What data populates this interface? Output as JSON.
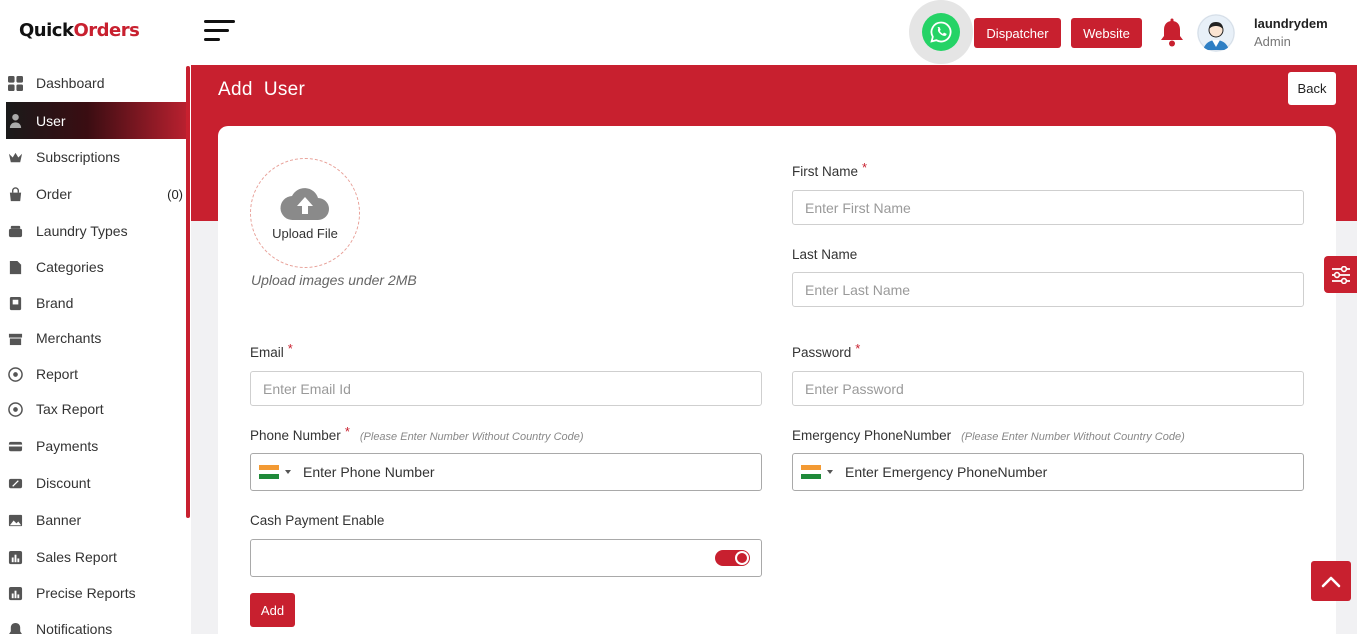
{
  "brand": {
    "logo_prefix": "Quick",
    "logo_mark": "O",
    "logo_suffix": "rders"
  },
  "sidebar": {
    "items": [
      {
        "label": "Dashboard",
        "icon": "dashboard-icon"
      },
      {
        "label": "User",
        "icon": "user-icon",
        "active": true
      },
      {
        "label": "Subscriptions",
        "icon": "crown-icon"
      },
      {
        "label": "Order",
        "icon": "bag-icon",
        "count": "(0)"
      },
      {
        "label": "Laundry Types",
        "icon": "laundry-icon"
      },
      {
        "label": "Categories",
        "icon": "categories-icon"
      },
      {
        "label": "Brand",
        "icon": "brand-icon"
      },
      {
        "label": "Merchants",
        "icon": "merchants-icon"
      },
      {
        "label": "Report",
        "icon": "report-icon"
      },
      {
        "label": "Tax Report",
        "icon": "tax-report-icon"
      },
      {
        "label": "Payments",
        "icon": "payments-icon"
      },
      {
        "label": "Discount",
        "icon": "discount-icon"
      },
      {
        "label": "Banner",
        "icon": "banner-icon"
      },
      {
        "label": "Sales Report",
        "icon": "sales-report-icon"
      },
      {
        "label": "Precise Reports",
        "icon": "precise-reports-icon"
      },
      {
        "label": "Notifications",
        "icon": "bell-icon"
      }
    ]
  },
  "topbar": {
    "dispatcher_label": "Dispatcher",
    "website_label": "Website",
    "user_name": "laundrydem",
    "user_role": "Admin"
  },
  "page": {
    "title": "Add  User",
    "back_label": "Back"
  },
  "form": {
    "upload_label": "Upload File",
    "upload_hint": "Upload images under 2MB",
    "first_name": {
      "label": "First Name",
      "required": "*",
      "placeholder": "Enter First Name",
      "value": ""
    },
    "last_name": {
      "label": "Last Name",
      "placeholder": "Enter Last Name",
      "value": ""
    },
    "email": {
      "label": "Email",
      "required": "*",
      "placeholder": "Enter Email Id",
      "value": ""
    },
    "password": {
      "label": "Password",
      "required": "*",
      "placeholder": "Enter Password",
      "value": ""
    },
    "phone": {
      "label": "Phone Number",
      "required": "*",
      "note": "(Please Enter Number Without Country Code)",
      "placeholder": "Enter Phone Number",
      "value": ""
    },
    "emergency_phone": {
      "label": "Emergency PhoneNumber",
      "note": "(Please Enter Number Without Country Code)",
      "placeholder": "Enter Emergency PhoneNumber",
      "value": ""
    },
    "cash_payment": {
      "label": "Cash Payment Enable",
      "enabled": true
    },
    "submit_label": "Add"
  },
  "colors": {
    "accent": "#c8202f",
    "whatsapp": "#25d366"
  }
}
